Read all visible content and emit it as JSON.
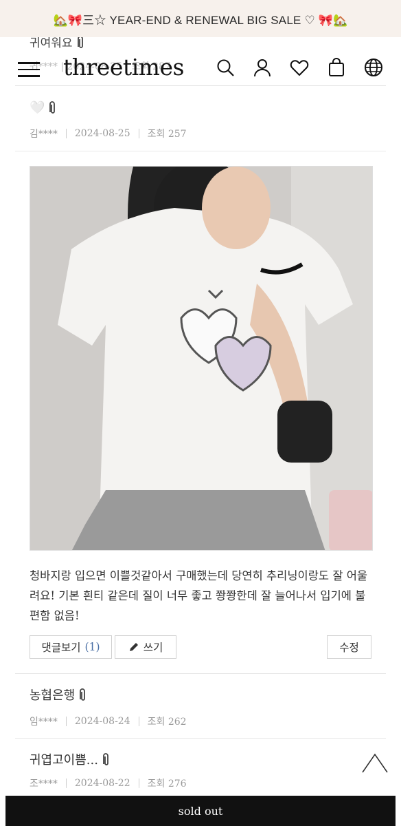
{
  "banner": {
    "text": "🏡🎀三☆ YEAR-END & RENEWAL BIG SALE ♡ 🎀🏡"
  },
  "header": {
    "logo": "threetimes",
    "underlay_title": "귀여워요",
    "underlay_meta": "귀**** | 2024-08-25 | 조회 287"
  },
  "reviews": [
    {
      "title": "🤍",
      "author": "김****",
      "date": "2024-08-25",
      "views": "조회 257"
    },
    {
      "text": "청바지랑 입으면 이쁠것같아서 구매했는데 당연히 추리닝이랑도 잘 어울려요! 기본 흰티 같은데 질이 너무 좋고 쫭쫭한데 잘 늘어나서 입기에 불편함 없음!",
      "comments_label": "댓글보기",
      "comments_count": "(1)",
      "write_label": "쓰기",
      "edit_label": "수정"
    },
    {
      "title": "농협은행",
      "author": "임****",
      "date": "2024-08-24",
      "views": "조회 262"
    },
    {
      "title": "귀엽고이쁨...",
      "author": "조****",
      "date": "2024-08-22",
      "views": "조회 276"
    }
  ],
  "footer": {
    "sold_out": "sold out"
  },
  "icons": [
    "menu-icon",
    "search-icon",
    "user-icon",
    "heart-icon",
    "bag-icon",
    "globe-icon",
    "paperclip-icon",
    "pencil-icon",
    "chevron-up-icon"
  ]
}
